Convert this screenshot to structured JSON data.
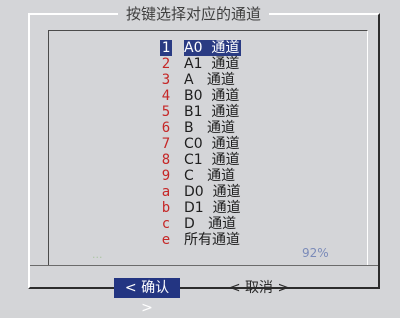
{
  "dialog": {
    "title": "按键选择对应的通道"
  },
  "menu": {
    "items": [
      {
        "key": "1",
        "label": "A0  通道",
        "selected": true
      },
      {
        "key": "2",
        "label": "A1  通道",
        "selected": false
      },
      {
        "key": "3",
        "label": "A   通道",
        "selected": false
      },
      {
        "key": "4",
        "label": "B0  通道",
        "selected": false
      },
      {
        "key": "5",
        "label": "B1  通道",
        "selected": false
      },
      {
        "key": "6",
        "label": "B   通道",
        "selected": false
      },
      {
        "key": "7",
        "label": "C0  通道",
        "selected": false
      },
      {
        "key": "8",
        "label": "C1  通道",
        "selected": false
      },
      {
        "key": "9",
        "label": "C   通道",
        "selected": false
      },
      {
        "key": "a",
        "label": "D0  通道",
        "selected": false
      },
      {
        "key": "b",
        "label": "D1  通道",
        "selected": false
      },
      {
        "key": "c",
        "label": "D   通道",
        "selected": false
      },
      {
        "key": "e",
        "label": "所有通道",
        "selected": false
      }
    ]
  },
  "status": {
    "left_text": "...",
    "progress_text": "92%"
  },
  "buttons": {
    "confirm_label": "< 确认 >",
    "cancel_label": "< 取消 >"
  },
  "colors": {
    "background": "#d4d5d8",
    "selection": "#2a3b83",
    "key_red": "#c52727",
    "progress_blue": "#7b8bb9"
  }
}
